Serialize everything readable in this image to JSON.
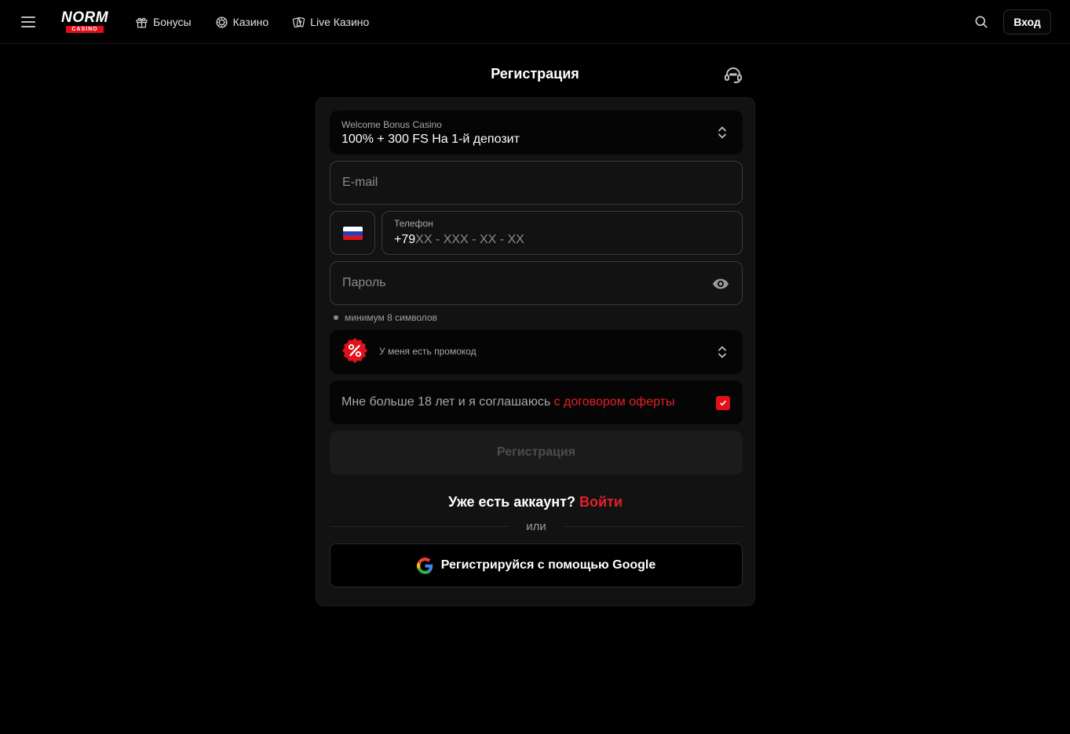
{
  "header": {
    "logo_top": "NORM",
    "logo_bottom": "CASINO",
    "nav": [
      {
        "label": "Бонусы",
        "icon": "gift-icon"
      },
      {
        "label": "Казино",
        "icon": "chip-icon"
      },
      {
        "label": "Live Казино",
        "icon": "cards-icon"
      }
    ],
    "login_label": "Вход"
  },
  "page": {
    "title": "Регистрация"
  },
  "form": {
    "bonus": {
      "label": "Welcome Bonus Casino",
      "value": "100% + 300 FS На 1-й депозит"
    },
    "email": {
      "placeholder": "E-mail"
    },
    "phone": {
      "label": "Телефон",
      "prefix": "+79",
      "mask": "XX - XXX - XX - XX",
      "country": "RU"
    },
    "password": {
      "placeholder": "Пароль"
    },
    "password_hint": "минимум 8 символов",
    "promo": {
      "label": "У меня есть промокод"
    },
    "terms": {
      "text": "Мне больше 18 лет и я соглашаюсь",
      "link": "с договором оферты",
      "checked": true
    },
    "submit_label": "Регистрация",
    "have_account": "Уже есть аккаунт?",
    "login_link": "Войти",
    "or": "или",
    "google_label": "Регистрируйся с помощью Google"
  },
  "colors": {
    "accent": "#e3101a",
    "background": "#000000",
    "card": "#121212"
  }
}
